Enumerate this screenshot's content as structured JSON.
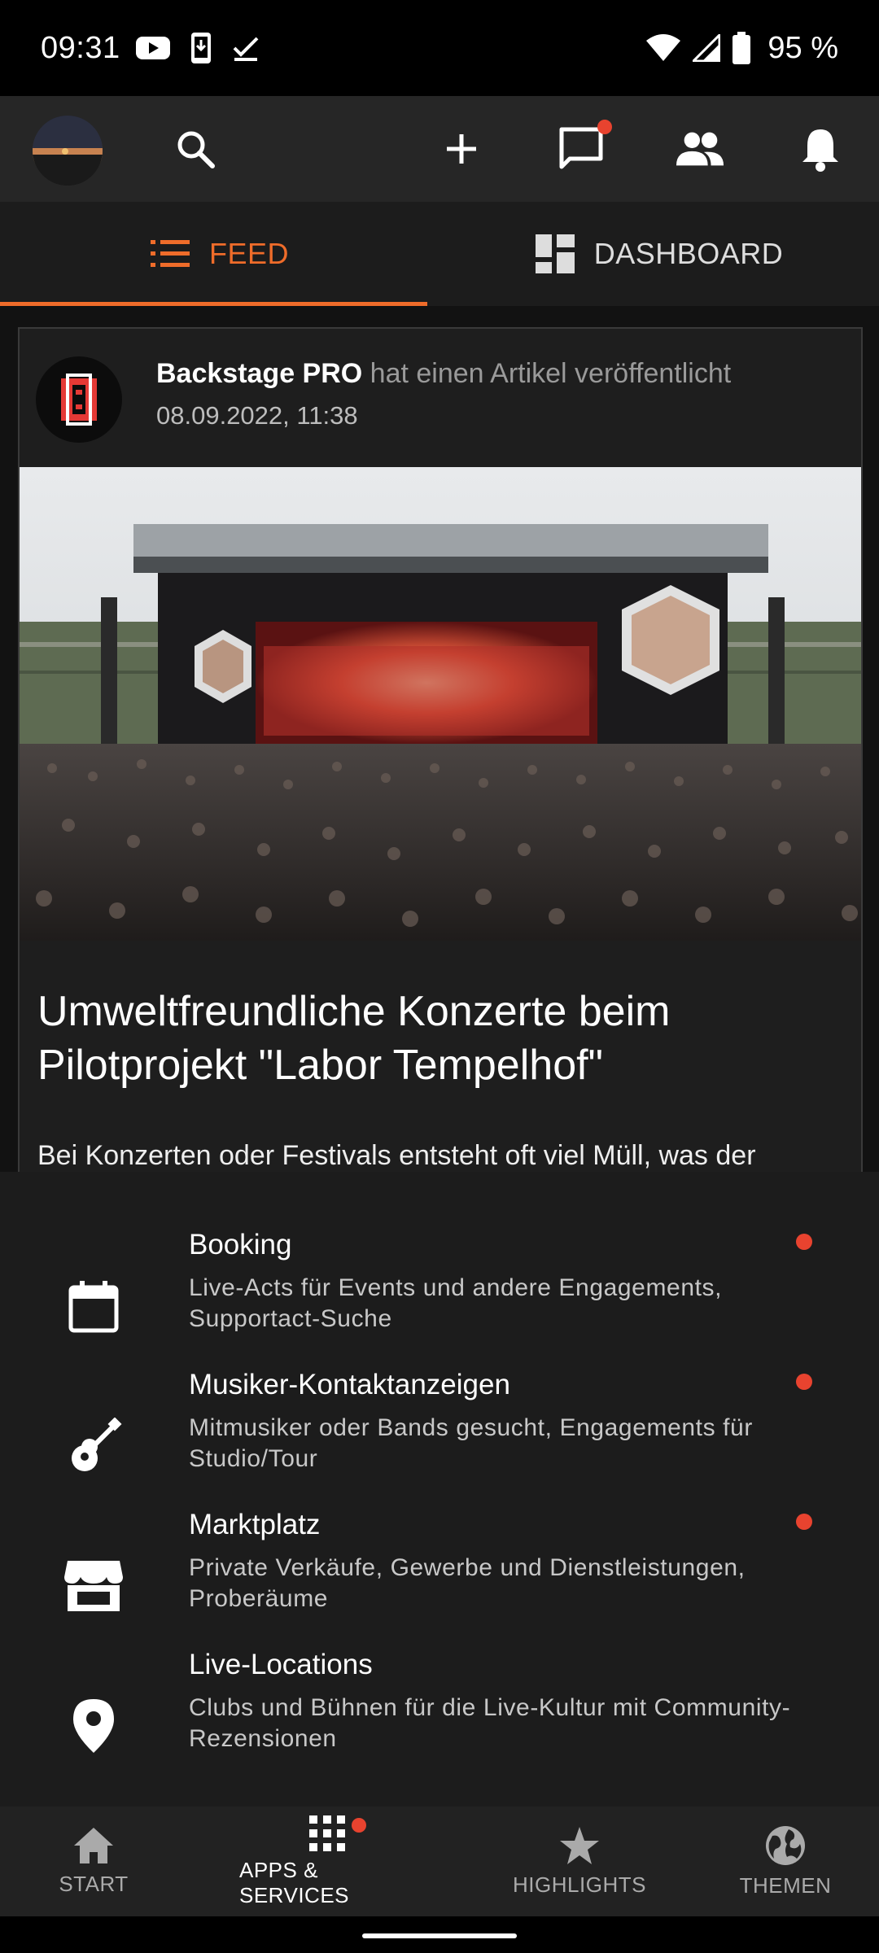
{
  "status_bar": {
    "time": "09:31",
    "battery": "95 %"
  },
  "app_bar": {
    "icons": [
      "avatar",
      "search-icon",
      "plus-icon",
      "chat-icon",
      "people-icon",
      "bell-icon"
    ],
    "chat_has_badge": true
  },
  "tabs": [
    {
      "label": "FEED",
      "icon": "list-icon",
      "active": true
    },
    {
      "label": "DASHBOARD",
      "icon": "dashboard-icon",
      "active": false
    }
  ],
  "feed": {
    "card": {
      "publisher": "Backstage PRO",
      "action": " hat einen Artikel veröffentlicht",
      "datetime": "08.09.2022, 11:38",
      "title": "Umweltfreundliche Konzerte beim Pilotprojekt \"Labor Tempelhof\"",
      "excerpt": "Bei Konzerten oder Festivals entsteht oft viel Müll, was der Umwelt schadet. Das Pilotprojekt Labor Tempelhof will dem"
    }
  },
  "sheet": {
    "items": [
      {
        "title": "Booking",
        "desc": "Live-Acts für Events und andere Engagements, Supportact-Suche",
        "icon": "calendar-icon",
        "badge": true
      },
      {
        "title": "Musiker-Kontaktanzeigen",
        "desc": "Mitmusiker oder Bands gesucht, Engagements für Studio/Tour",
        "icon": "guitar-icon",
        "badge": true
      },
      {
        "title": "Marktplatz",
        "desc": "Private Verkäufe, Gewerbe und Dienstleistungen, Proberäume",
        "icon": "store-icon",
        "badge": true
      },
      {
        "title": "Live-Locations",
        "desc": "Clubs und Bühnen für die Live-Kultur mit Community-Rezensionen",
        "icon": "location-pin-icon",
        "badge": false
      }
    ]
  },
  "bottom_nav": [
    {
      "label": "START",
      "icon": "home-icon",
      "active": false
    },
    {
      "label": "APPS & SERVICES",
      "icon": "apps-grid-icon",
      "active": true,
      "badge": true
    },
    {
      "label": "HIGHLIGHTS",
      "icon": "star-icon",
      "active": false
    },
    {
      "label": "THEMEN",
      "icon": "globe-icon",
      "active": false
    }
  ],
  "colors": {
    "accent": "#ef6c2a",
    "badge": "#e8432f",
    "background": "#121212",
    "surface": "#1e1e1e"
  }
}
